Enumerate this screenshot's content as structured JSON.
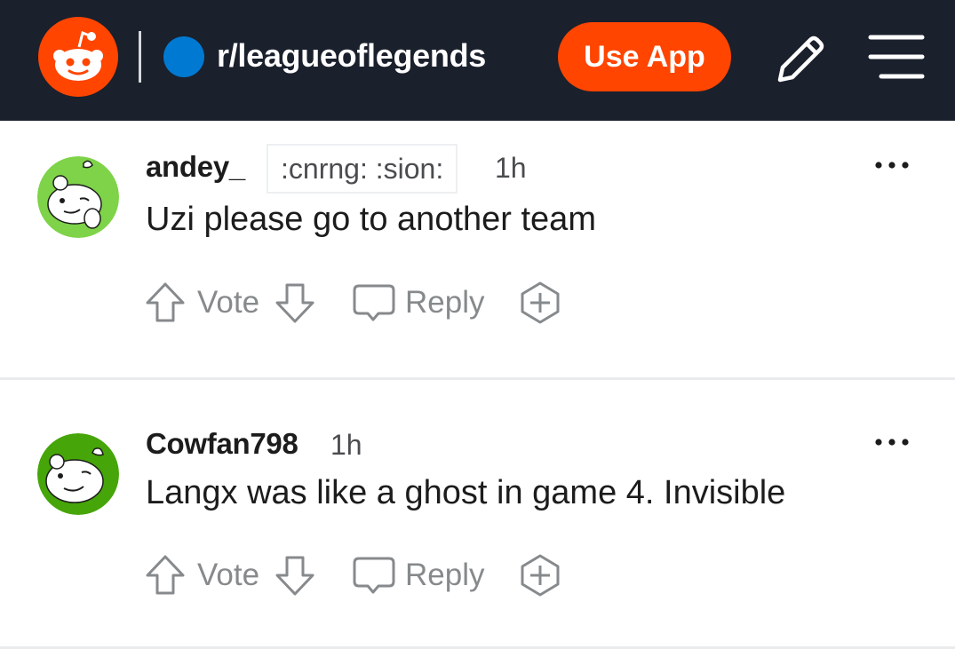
{
  "header": {
    "subreddit": "r/leagueoflegends",
    "use_app_label": "Use App",
    "logo_icon": "reddit-logo-icon",
    "pencil_icon": "pencil-icon",
    "menu_icon": "hamburger-menu-icon",
    "colors": {
      "bar": "#1a202c",
      "brand": "#ff4500",
      "subreddit_dot": "#0079d3"
    }
  },
  "comments": [
    {
      "username": "andey_",
      "flair": ":cnrng: :sion:",
      "time": "1h",
      "body": "Uzi please go to another team",
      "vote_label": "Vote",
      "reply_label": "Reply",
      "avatar_color": "#7ed348"
    },
    {
      "username": "Cowfan798",
      "flair": "",
      "time": "1h",
      "body": "Langx was like a ghost in game 4. Invisible",
      "vote_label": "Vote",
      "reply_label": "Reply",
      "avatar_color": "#46a508"
    }
  ],
  "icons": {
    "upvote": "upvote-arrow-icon",
    "downvote": "downvote-arrow-icon",
    "reply": "speech-bubble-icon",
    "award": "award-plus-icon",
    "more": "more-dots-icon"
  }
}
